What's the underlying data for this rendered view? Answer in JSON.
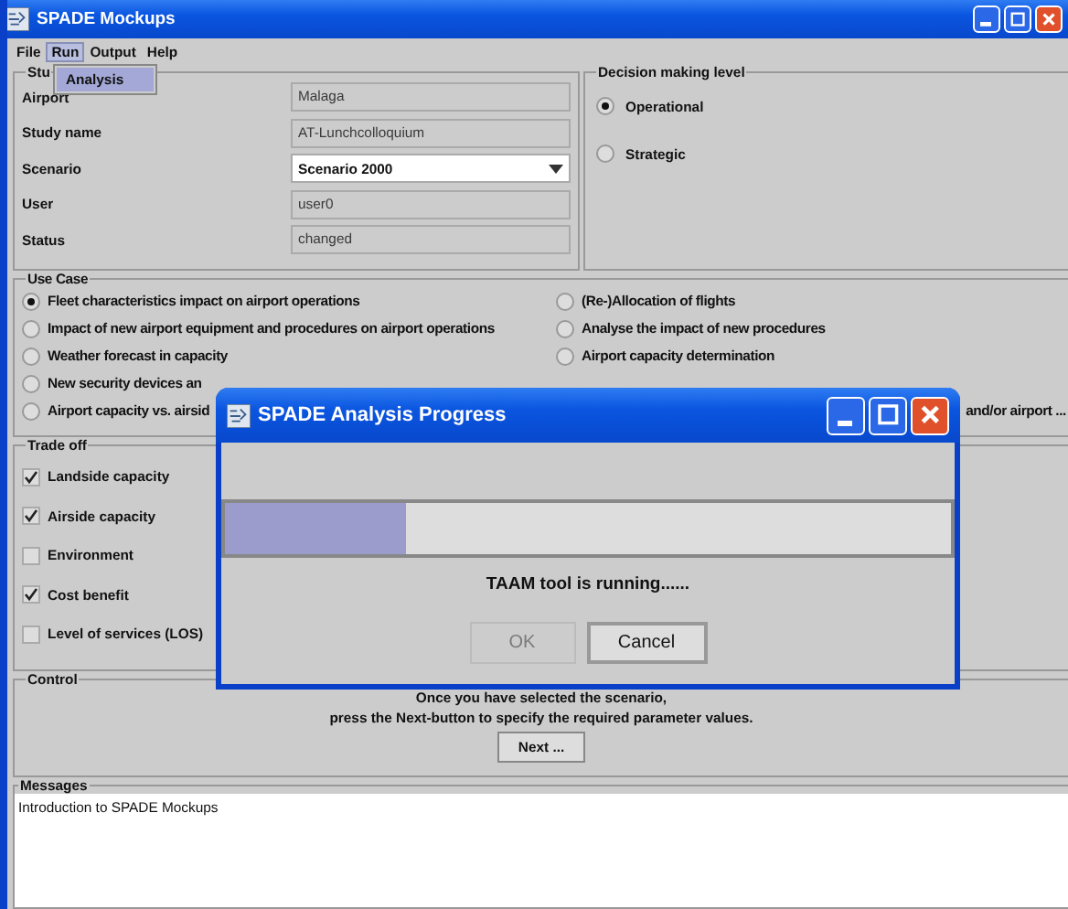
{
  "window": {
    "title": "SPADE Mockups"
  },
  "menu": [
    {
      "label": "File",
      "selected": false
    },
    {
      "label": "Run",
      "selected": true
    },
    {
      "label": "Output",
      "selected": false
    },
    {
      "label": "Help",
      "selected": false
    }
  ],
  "open_menu": {
    "items": [
      {
        "label": "Analysis",
        "selected": true
      }
    ]
  },
  "study": {
    "legend": "Stu",
    "fields": [
      {
        "label": "Airport",
        "kind": "text",
        "value": "Malaga"
      },
      {
        "label": "Study name",
        "kind": "text",
        "value": "AT-Lunchcolloquium"
      },
      {
        "label": "Scenario",
        "kind": "combo",
        "value": "Scenario 2000"
      },
      {
        "label": "User",
        "kind": "text",
        "value": "user0"
      },
      {
        "label": "Status",
        "kind": "text",
        "value": "changed"
      }
    ]
  },
  "decision": {
    "legend": "Decision making level",
    "options": [
      {
        "label": "Operational",
        "selected": true
      },
      {
        "label": "Strategic",
        "selected": false
      }
    ]
  },
  "use_case": {
    "legend": "Use Case",
    "left": [
      {
        "label": "Fleet characteristics impact on airport operations",
        "selected": true
      },
      {
        "label": "Impact of new airport equipment and procedures on airport operations",
        "selected": false
      },
      {
        "label": "Weather forecast in capacity",
        "selected": false
      },
      {
        "label": "New security devices an",
        "selected": false
      },
      {
        "label": "Airport capacity vs. airsid",
        "selected": false
      }
    ],
    "right": [
      {
        "kind": "radio",
        "label": "(Re-)Allocation of flights",
        "selected": false
      },
      {
        "kind": "radio",
        "label": "Analyse the impact of new procedures",
        "selected": false
      },
      {
        "kind": "radio",
        "label": "Airport capacity determination",
        "selected": false
      },
      {
        "kind": "hidden"
      },
      {
        "kind": "fragment",
        "label": "and/or airport ..."
      }
    ]
  },
  "trade_off": {
    "legend": "Trade off",
    "options": [
      {
        "label": "Landside capacity",
        "checked": true
      },
      {
        "label": "Airside capacity",
        "checked": true
      },
      {
        "label": "Environment",
        "checked": false
      },
      {
        "label": "Cost benefit",
        "checked": true
      },
      {
        "label": "Level of services (LOS)",
        "checked": false
      }
    ]
  },
  "control": {
    "legend": "Control",
    "lines": [
      "Once you have selected the scenario,",
      "press the Next-button to specify the required parameter values."
    ],
    "button": "Next ..."
  },
  "messages": {
    "legend": "Messages",
    "lines": [
      "Introduction to SPADE Mockups"
    ]
  },
  "dialog": {
    "title": "SPADE Analysis Progress",
    "level": 0.25,
    "status": "TAAM tool is running......",
    "buttons": [
      {
        "label": "OK",
        "disabled": true
      },
      {
        "label": "Cancel",
        "disabled": false
      }
    ]
  }
}
